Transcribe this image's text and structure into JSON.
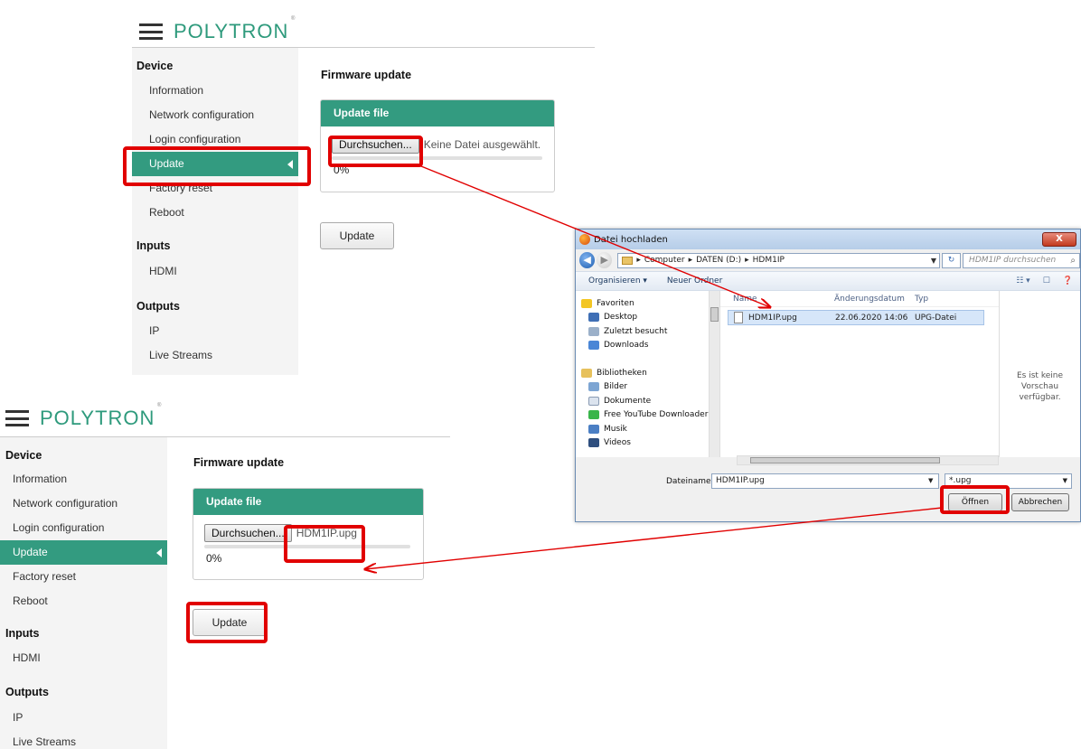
{
  "brand": {
    "logo_text": "POLYTRON",
    "reg_mark": "®"
  },
  "sidebar": {
    "sections": [
      {
        "title": "Device",
        "items": [
          "Information",
          "Network configuration",
          "Login configuration",
          "Update",
          "Factory reset",
          "Reboot"
        ]
      },
      {
        "title": "Inputs",
        "items": [
          "HDMI"
        ]
      },
      {
        "title": "Outputs",
        "items": [
          "IP",
          "Live Streams"
        ]
      }
    ],
    "active_item": "Update"
  },
  "main": {
    "title": "Firmware update",
    "card_title": "Update file",
    "browse_label": "Durchsuchen...",
    "progress_text": "0%",
    "progress_value": 0,
    "update_label": "Update"
  },
  "state_before": {
    "file_status": "Keine Datei ausgewählt."
  },
  "state_after": {
    "file_status": "HDM1IP.upg"
  },
  "dialog": {
    "title": "Datei hochladen",
    "close_label": "X",
    "path": [
      "Computer",
      "DATEN (D:)",
      "HDM1IP"
    ],
    "search_placeholder": "HDM1IP durchsuchen",
    "toolbar": {
      "organize": "Organisieren ▾",
      "new_folder": "Neuer Ordner"
    },
    "tree": [
      {
        "label": "Favoriten",
        "level": 0,
        "icon": "star-icon"
      },
      {
        "label": "Desktop",
        "level": 1,
        "icon": "desktop-icon"
      },
      {
        "label": "Zuletzt besucht",
        "level": 1,
        "icon": "recent-icon"
      },
      {
        "label": "Downloads",
        "level": 1,
        "icon": "downloads-icon"
      },
      {
        "label": "Bibliotheken",
        "level": 0,
        "icon": "library-icon"
      },
      {
        "label": "Bilder",
        "level": 1,
        "icon": "pictures-icon"
      },
      {
        "label": "Dokumente",
        "level": 1,
        "icon": "documents-icon"
      },
      {
        "label": "Free YouTube Downloader",
        "level": 1,
        "icon": "download-app-icon"
      },
      {
        "label": "Musik",
        "level": 1,
        "icon": "music-icon"
      },
      {
        "label": "Videos",
        "level": 1,
        "icon": "videos-icon"
      }
    ],
    "columns": {
      "name": "Name",
      "date": "Änderungsdatum",
      "type": "Typ"
    },
    "file": {
      "name": "HDM1IP.upg",
      "date": "22.06.2020 14:06",
      "type": "UPG-Datei"
    },
    "preview_text": "Es ist keine Vorschau verfügbar.",
    "filename_label": "Dateiname:",
    "filename_value": "HDM1IP.upg",
    "filter_value": "*.upg",
    "open_label": "Öffnen",
    "cancel_label": "Abbrechen"
  },
  "colors": {
    "accent": "#339b80",
    "highlight": "#e10000"
  }
}
